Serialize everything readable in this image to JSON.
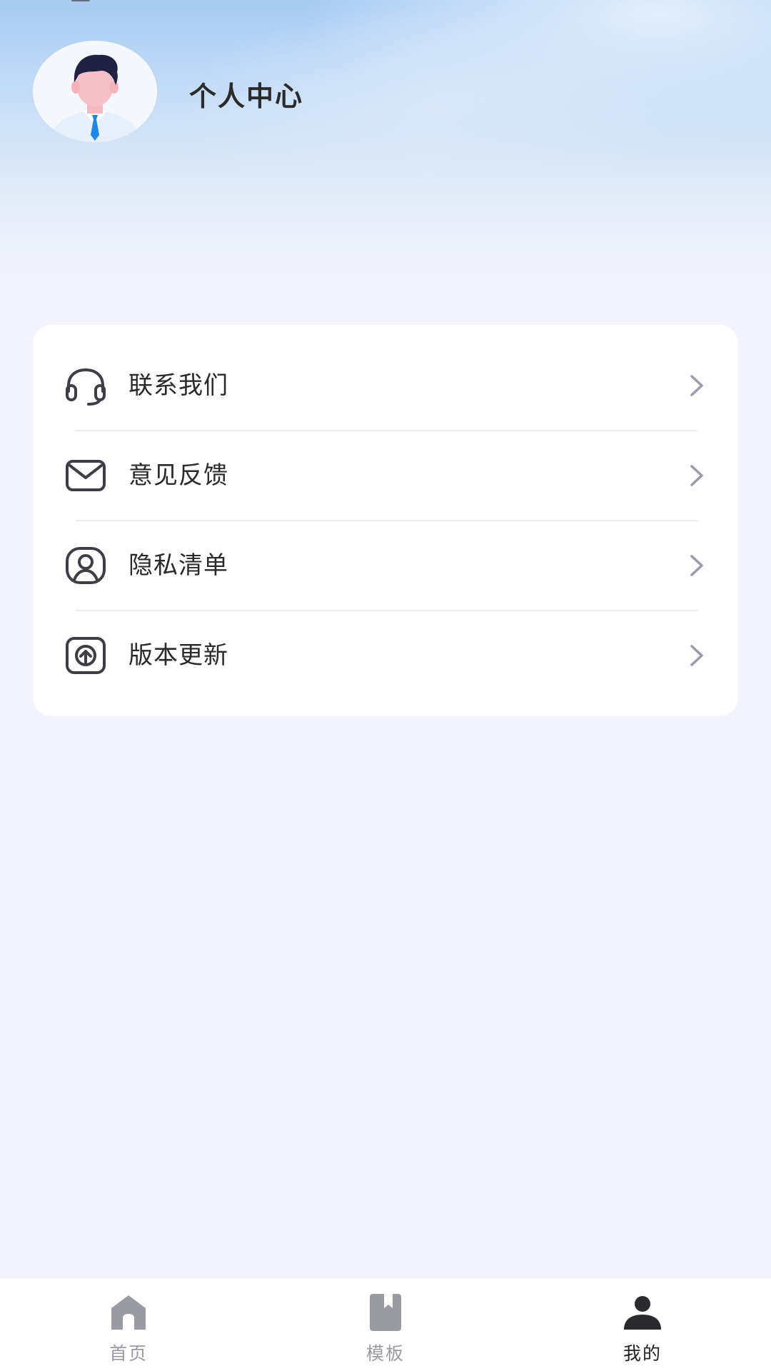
{
  "header": {
    "title": "个人中心"
  },
  "menu": {
    "items": [
      {
        "label": "联系我们",
        "icon": "headset-icon"
      },
      {
        "label": "意见反馈",
        "icon": "mail-icon"
      },
      {
        "label": "隐私清单",
        "icon": "user-privacy-icon"
      },
      {
        "label": "版本更新",
        "icon": "upload-update-icon"
      }
    ]
  },
  "tabbar": {
    "tabs": [
      {
        "label": "首页",
        "icon": "home-icon",
        "active": false
      },
      {
        "label": "模板",
        "icon": "bookmark-book-icon",
        "active": false
      },
      {
        "label": "我的",
        "icon": "person-icon",
        "active": true
      }
    ]
  },
  "colors": {
    "background": "#f3f3fd",
    "header_gradient_top": "#a9cbf1",
    "card": "#ffffff",
    "text_primary": "#2a2a2a",
    "tab_inactive": "#9a9aa2",
    "tab_active": "#222222",
    "icon_dark": "#3e3e44",
    "chevron": "#9a9aa8"
  }
}
